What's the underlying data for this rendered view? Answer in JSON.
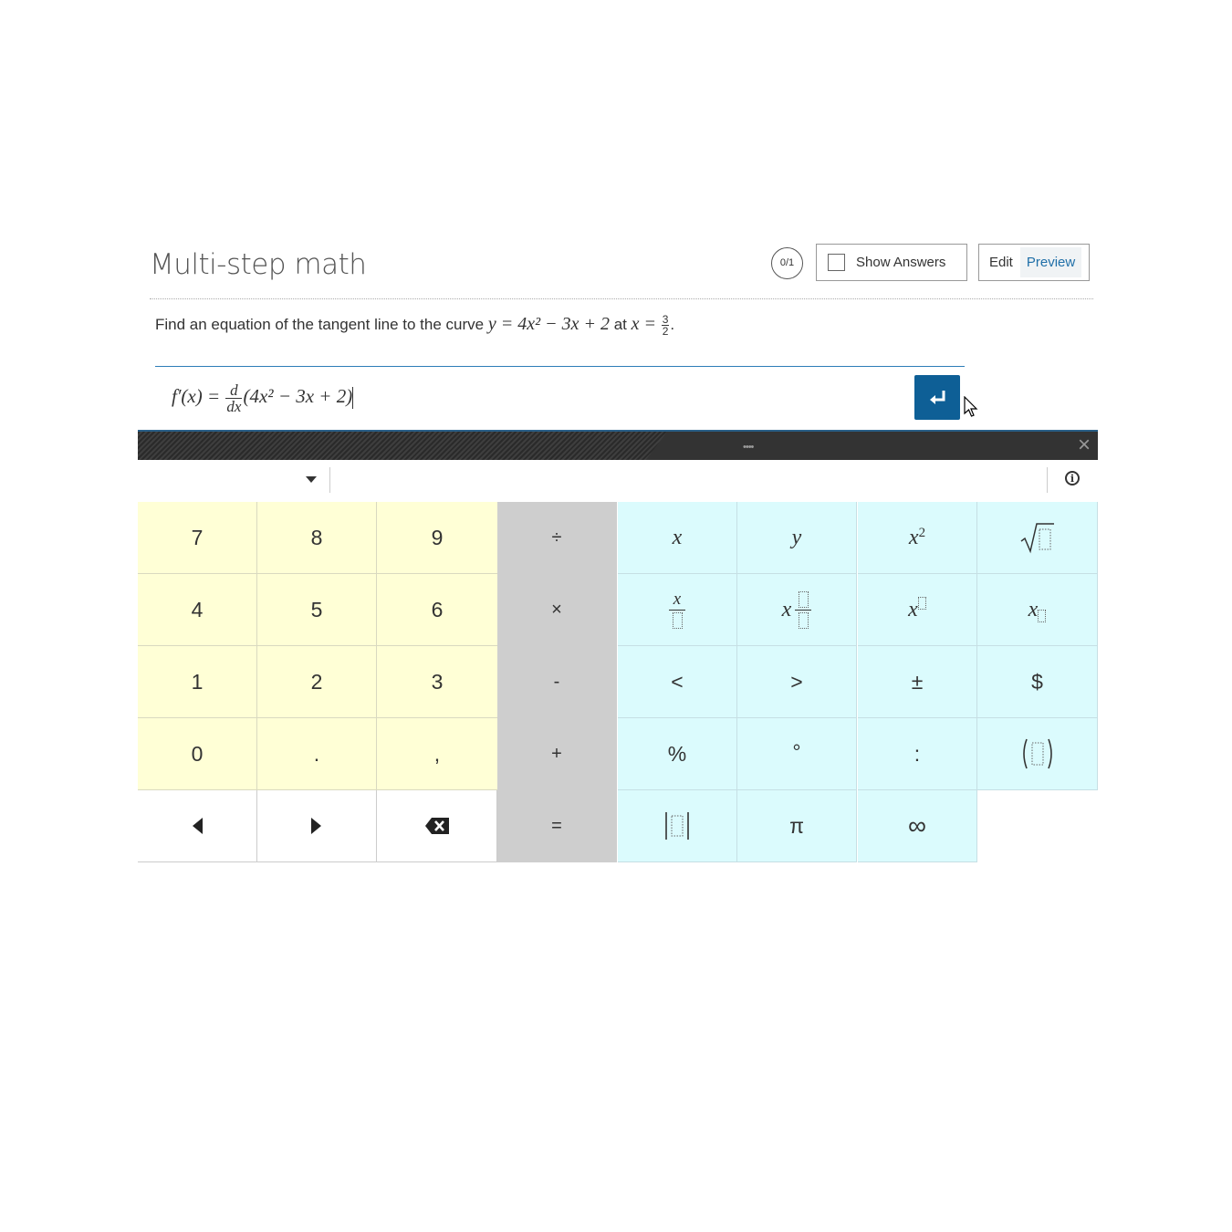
{
  "header": {
    "title": "Multi-step math",
    "score": "0/1",
    "show_answers_label": "Show Answers",
    "edit_label": "Edit",
    "preview_label": "Preview"
  },
  "question": {
    "prefix": "Find an equation of the tangent line to the curve",
    "equation": "y = 4x² − 3x + 2",
    "middle": "at",
    "condition_lhs": "x =",
    "condition_num": "3",
    "condition_den": "2",
    "suffix": "."
  },
  "answer": {
    "lhs": "f′(x) =",
    "deriv_num": "d",
    "deriv_den": "dx",
    "expression": "(4x² − 3x + 2)"
  },
  "keyboard": {
    "grip": "••••",
    "close": "×",
    "info": "i",
    "numbers": [
      "7",
      "8",
      "9",
      "4",
      "5",
      "6",
      "1",
      "2",
      "3",
      "0",
      ".",
      ","
    ],
    "operators": [
      "÷",
      "×",
      "-",
      "+",
      "="
    ],
    "symbols": {
      "x": "x",
      "y": "y",
      "x_sq": "x",
      "sq": "2",
      "less": "<",
      "greater": ">",
      "plusminus": "±",
      "dollar": "$",
      "percent": "%",
      "degree": "°",
      "colon": ":",
      "pi": "π",
      "infinity": "∞"
    }
  },
  "colors": {
    "accent": "#0e5f96",
    "num_key": "#ffffd6",
    "op_key": "#cecece",
    "sym_key": "#dbfbfd"
  }
}
